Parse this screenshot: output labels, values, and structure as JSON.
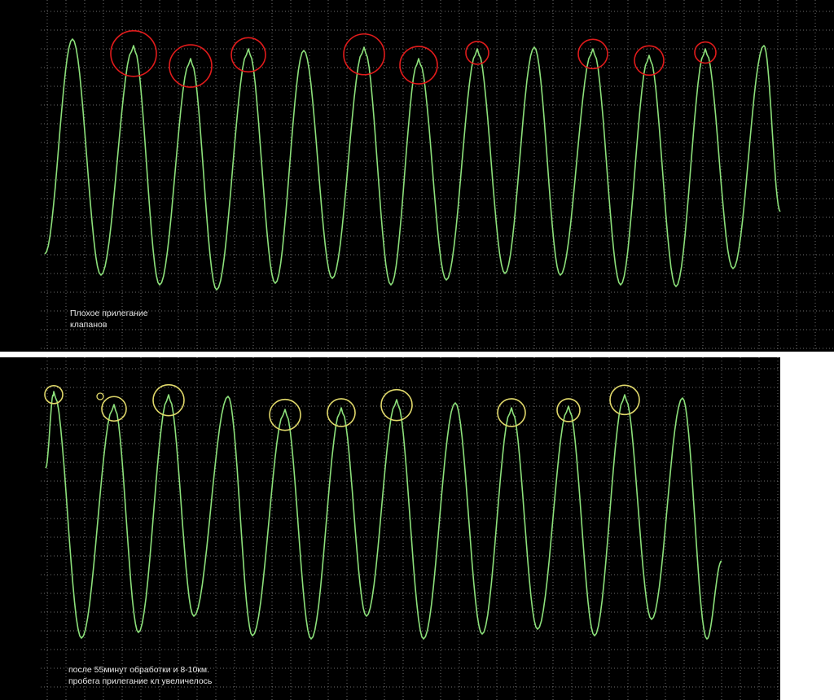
{
  "chart_data": [
    {
      "type": "line",
      "title": "",
      "xlabel": "",
      "ylabel": "",
      "grid": true,
      "colors": {
        "background": "#000000",
        "grid": "#6e6e6e",
        "trace": "#8ce07a",
        "marker": "#e01b1b"
      },
      "annotation": "Плохое прилегание\nклапанов",
      "series": [
        {
          "name": "",
          "peaks": [
            {
              "x": 89,
              "y": 48,
              "notch": false,
              "marked": false
            },
            {
              "x": 164,
              "y": 56,
              "notch": true,
              "marked": true,
              "r": 28
            },
            {
              "x": 234,
              "y": 72,
              "notch": true,
              "marked": true,
              "r": 26
            },
            {
              "x": 305,
              "y": 60,
              "notch": true,
              "marked": true,
              "r": 21
            },
            {
              "x": 373,
              "y": 62,
              "notch": false,
              "marked": false
            },
            {
              "x": 447,
              "y": 58,
              "notch": true,
              "marked": true,
              "r": 25
            },
            {
              "x": 514,
              "y": 72,
              "notch": true,
              "marked": true,
              "r": 23
            },
            {
              "x": 586,
              "y": 60,
              "notch": true,
              "marked": true,
              "r": 14
            },
            {
              "x": 656,
              "y": 58,
              "notch": false,
              "marked": false
            },
            {
              "x": 728,
              "y": 60,
              "notch": true,
              "marked": true,
              "r": 18
            },
            {
              "x": 797,
              "y": 68,
              "notch": true,
              "marked": true,
              "r": 18
            },
            {
              "x": 866,
              "y": 60,
              "notch": true,
              "marked": true,
              "r": 13
            },
            {
              "x": 938,
              "y": 56,
              "notch": false,
              "marked": false
            }
          ],
          "troughs": [
            {
              "x": 124,
              "y": 338
            },
            {
              "x": 196,
              "y": 350
            },
            {
              "x": 266,
              "y": 356
            },
            {
              "x": 338,
              "y": 348
            },
            {
              "x": 408,
              "y": 342
            },
            {
              "x": 480,
              "y": 350
            },
            {
              "x": 548,
              "y": 344
            },
            {
              "x": 620,
              "y": 336
            },
            {
              "x": 688,
              "y": 338
            },
            {
              "x": 762,
              "y": 350
            },
            {
              "x": 830,
              "y": 352
            },
            {
              "x": 900,
              "y": 330
            }
          ],
          "start": {
            "x": 55,
            "y": 312
          },
          "end": {
            "x": 958,
            "y": 260
          }
        }
      ]
    },
    {
      "type": "line",
      "title": "",
      "xlabel": "",
      "ylabel": "",
      "grid": true,
      "colors": {
        "background": "#000000",
        "grid": "#6e6e6e",
        "trace": "#8ce07a",
        "marker": "#e0d86a"
      },
      "annotation": "после 55минут обработки и 8-10км.\nпробега прилегание кл увеличелось",
      "series": [
        {
          "name": "",
          "peaks": [
            {
              "x": 66,
              "y": 42,
              "notch": true,
              "marked": true,
              "r": 11
            },
            {
              "x": 140,
              "y": 58,
              "notch": true,
              "marked": true,
              "r": 15
            },
            {
              "x": 207,
              "y": 46,
              "notch": true,
              "marked": true,
              "r": 19
            },
            {
              "x": 280,
              "y": 48,
              "notch": false,
              "marked": false
            },
            {
              "x": 350,
              "y": 64,
              "notch": true,
              "marked": true,
              "r": 19
            },
            {
              "x": 419,
              "y": 62,
              "notch": true,
              "marked": true,
              "r": 17
            },
            {
              "x": 487,
              "y": 52,
              "notch": true,
              "marked": true,
              "r": 19
            },
            {
              "x": 559,
              "y": 56,
              "notch": false,
              "marked": false
            },
            {
              "x": 628,
              "y": 62,
              "notch": true,
              "marked": true,
              "r": 17
            },
            {
              "x": 698,
              "y": 60,
              "notch": true,
              "marked": true,
              "r": 14
            },
            {
              "x": 767,
              "y": 46,
              "notch": true,
              "marked": true,
              "r": 18
            },
            {
              "x": 838,
              "y": 50,
              "notch": false,
              "marked": false
            }
          ],
          "troughs": [
            {
              "x": 100,
              "y": 345
            },
            {
              "x": 170,
              "y": 338
            },
            {
              "x": 238,
              "y": 318
            },
            {
              "x": 310,
              "y": 342
            },
            {
              "x": 382,
              "y": 346
            },
            {
              "x": 450,
              "y": 318
            },
            {
              "x": 520,
              "y": 346
            },
            {
              "x": 592,
              "y": 340
            },
            {
              "x": 660,
              "y": 334
            },
            {
              "x": 730,
              "y": 342
            },
            {
              "x": 800,
              "y": 322
            },
            {
              "x": 868,
              "y": 346
            }
          ],
          "start": {
            "x": 56,
            "y": 136
          },
          "end": {
            "x": 886,
            "y": 250
          },
          "extra_markers": [
            {
              "x": 123,
              "y": 48,
              "r": 4
            }
          ]
        }
      ]
    }
  ]
}
